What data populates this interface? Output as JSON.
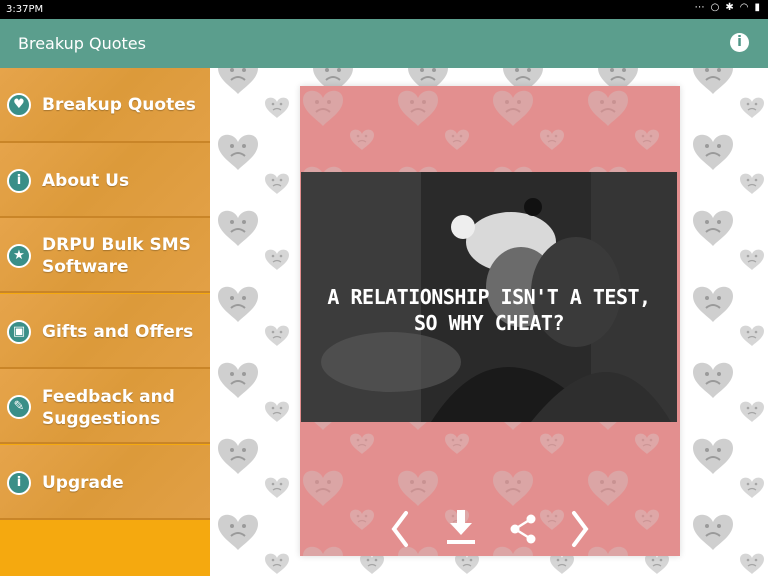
{
  "status_bar": {
    "time": "3:37PM"
  },
  "app_bar": {
    "title": "Breakup Quotes"
  },
  "drawer": {
    "items": [
      {
        "label": "Breakup Quotes",
        "icon": "broken-heart-icon"
      },
      {
        "label": "About Us",
        "icon": "info-icon"
      },
      {
        "label": "DRPU Bulk SMS Software",
        "label_lines": [
          "DRPU Bulk SMS",
          "Software"
        ],
        "icon": "star-icon"
      },
      {
        "label": "Gifts and Offers",
        "icon": "gift-icon"
      },
      {
        "label": "Feedback and Suggestions",
        "label_lines": [
          "Feedback and",
          "Suggestions"
        ],
        "icon": "feedback-icon"
      },
      {
        "label": "Upgrade",
        "icon": "info-icon"
      }
    ]
  },
  "card": {
    "quote_lines": [
      "A RELATIONSHIP ISN'T A TEST,",
      "SO WHY CHEAT?"
    ]
  },
  "colors": {
    "app_bar": "#5b9e8d",
    "drawer_bg": "#f5a90f",
    "card_bg": "#e38f8f",
    "icon_teal": "#3a8f88"
  }
}
